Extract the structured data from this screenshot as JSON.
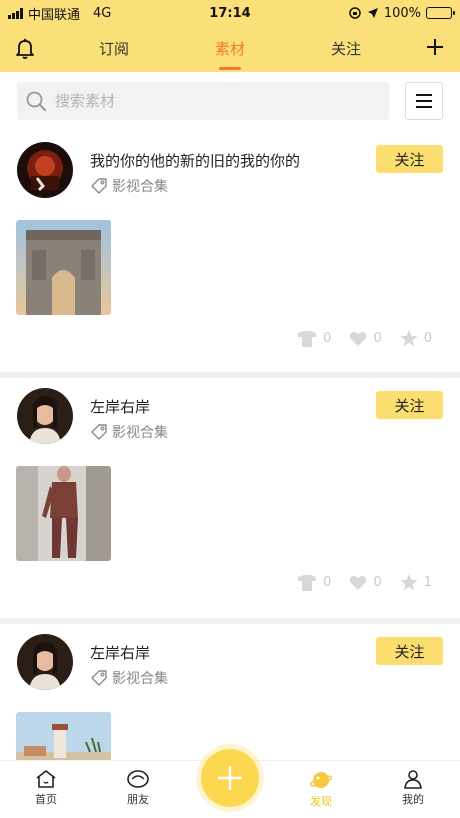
{
  "status_bar": {
    "carrier": "中国联通",
    "network": "4G",
    "time": "17:14",
    "battery_pct": "100%"
  },
  "top_nav": {
    "tabs": [
      {
        "label": "订阅"
      },
      {
        "label": "素材"
      },
      {
        "label": "关注"
      }
    ],
    "active_tab": "素材"
  },
  "search": {
    "placeholder": "搜索素材"
  },
  "posts": [
    {
      "author": "我的你的他的新的旧的我的你的",
      "tag": "影视合集",
      "follow_label": "关注",
      "stats": {
        "share": "0",
        "like": "0",
        "star": "0"
      }
    },
    {
      "author": "左岸右岸",
      "tag": "影视合集",
      "follow_label": "关注",
      "stats": {
        "share": "0",
        "like": "0",
        "star": "1"
      }
    },
    {
      "author": "左岸右岸",
      "tag": "影视合集",
      "follow_label": "关注"
    }
  ],
  "bottom_nav": {
    "items": [
      {
        "label": "首页"
      },
      {
        "label": "朋友"
      },
      {
        "label": "发现"
      },
      {
        "label": "我的"
      }
    ],
    "active": "发现"
  },
  "colors": {
    "brand_yellow": "#fbe07a",
    "follow_yellow": "#fbde6f",
    "active_tab": "#f07b2b",
    "active_bottom": "#f0c419"
  }
}
